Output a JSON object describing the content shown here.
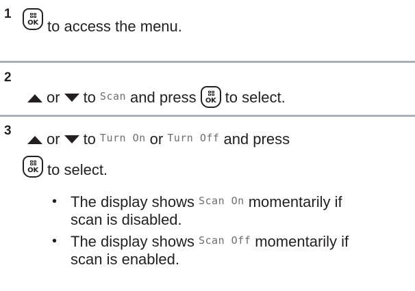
{
  "steps": [
    {
      "number": "1",
      "text": "to access the menu."
    },
    {
      "number": "2",
      "or": "or",
      "to": "to",
      "target": "Scan",
      "and_press": "and press",
      "select": "to select."
    },
    {
      "number": "3",
      "or": "or",
      "to": "to",
      "option_on": "Turn On",
      "or_between": "or",
      "option_off": "Turn Off",
      "and_press": "and press",
      "select": "to select.",
      "bullets": [
        {
          "prefix": "The display shows",
          "code": "Scan On",
          "suffix": "momentarily if",
          "continuation": "scan is disabled."
        },
        {
          "prefix": "The display shows",
          "code": "Scan Off",
          "suffix": "momentarily if",
          "continuation": "scan is enabled."
        }
      ]
    }
  ],
  "icons": {
    "ok_key_label": "OK",
    "ok_key": "menu-ok-key-icon",
    "up": "up-arrow-icon",
    "down": "down-arrow-icon"
  },
  "colors": {
    "divider": "#a7b1b8",
    "text": "#231f20",
    "code": "#6e6e6e"
  }
}
